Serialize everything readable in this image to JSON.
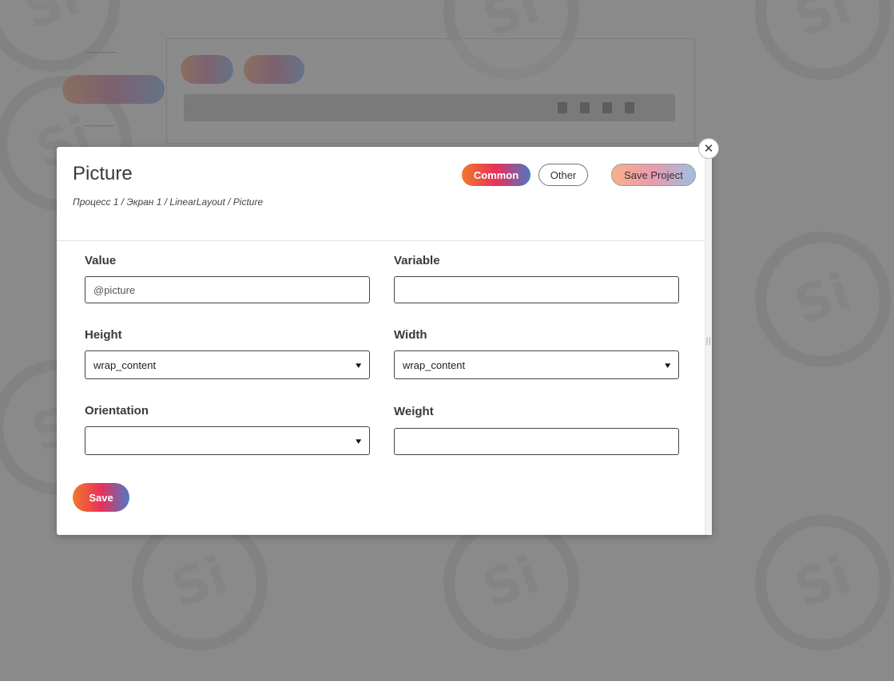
{
  "modal": {
    "title": "Picture",
    "breadcrumb": "Процесс 1 / Экран 1 / LinearLayout / Picture",
    "close_symbol": "✕",
    "tabs": {
      "common_label": "Common",
      "other_label": "Other"
    },
    "save_project_label": "Save Project",
    "fields": {
      "value": {
        "label": "Value",
        "value": "@picture"
      },
      "variable": {
        "label": "Variable",
        "value": ""
      },
      "height": {
        "label": "Height",
        "selected": "wrap_content"
      },
      "width": {
        "label": "Width",
        "selected": "wrap_content"
      },
      "orientation": {
        "label": "Orientation",
        "selected": ""
      },
      "weight": {
        "label": "Weight",
        "value": ""
      }
    },
    "save_label": "Save"
  },
  "icons": {
    "close": "close-icon",
    "chevron": "chevron-down-icon"
  },
  "colors": {
    "accent_gradient_start": "#f07a2a",
    "accent_gradient_mid": "#e8305a",
    "accent_gradient_end": "#4f78c4"
  }
}
